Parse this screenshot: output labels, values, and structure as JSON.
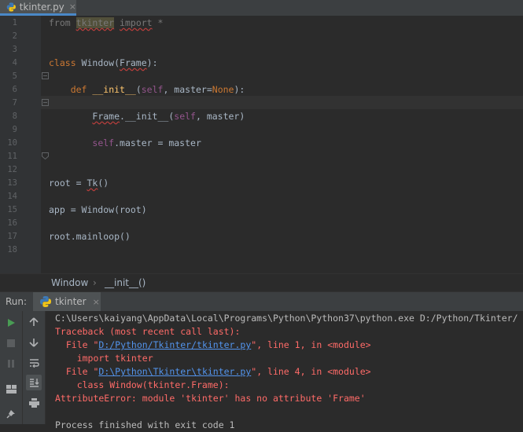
{
  "editor_tab": {
    "filename": "tkinter.py",
    "close": "×"
  },
  "code_lines": [
    {
      "n": "1",
      "html": "<span class='dim'>from</span> <span class='dim hl warn'>tkinter</span> <span class='dim warn'>import</span> <span class='dim'>*</span>"
    },
    {
      "n": "2",
      "html": ""
    },
    {
      "n": "3",
      "html": ""
    },
    {
      "n": "4",
      "html": "<span class='kw'>class</span> Window(<span class='warn'>Frame</span>):"
    },
    {
      "n": "5",
      "html": ""
    },
    {
      "n": "6",
      "html": "    <span class='kw'>def</span> <span class='fn'>__init__</span>(<span class='self'>self</span>, master=<span class='kw'>None</span>):"
    },
    {
      "n": "7",
      "html": ""
    },
    {
      "n": "8",
      "html": "        <span class='warn'>Frame</span>.__init__(<span class='self'>self</span>, master)"
    },
    {
      "n": "9",
      "html": ""
    },
    {
      "n": "10",
      "html": "        <span class='self'>self</span>.master = master"
    },
    {
      "n": "11",
      "html": ""
    },
    {
      "n": "12",
      "html": ""
    },
    {
      "n": "13",
      "html": "root = <span class='warn'>Tk</span>()"
    },
    {
      "n": "14",
      "html": ""
    },
    {
      "n": "15",
      "html": "app = Window(root)"
    },
    {
      "n": "16",
      "html": ""
    },
    {
      "n": "17",
      "html": "root.mainloop()"
    },
    {
      "n": "18",
      "html": ""
    }
  ],
  "breadcrumb": {
    "class_name": "Window",
    "separator": "›",
    "method_name": "__init__()"
  },
  "run_panel": {
    "label": "Run:",
    "tab_name": "tkinter",
    "close": "×"
  },
  "console_lines": [
    {
      "cls": "gray",
      "text": "C:\\Users\\kaiyang\\AppData\\Local\\Programs\\Python\\Python37\\python.exe D:/Python/Tkinter/"
    },
    {
      "cls": "red",
      "text": "Traceback (most recent call last):"
    },
    {
      "cls": "red",
      "html": "  File \"<span class='link'>D:/Python/Tkinter/tkinter.py</span>\", line 1, in &lt;module&gt;"
    },
    {
      "cls": "red",
      "text": "    import tkinter"
    },
    {
      "cls": "red",
      "html": "  File \"<span class='link'>D:\\Python\\Tkinter\\tkinter.py</span>\", line 4, in &lt;module&gt;"
    },
    {
      "cls": "red",
      "text": "    class Window(tkinter.Frame):"
    },
    {
      "cls": "red",
      "text": "AttributeError: module 'tkinter' has no attribute 'Frame'"
    },
    {
      "cls": "gray",
      "text": ""
    },
    {
      "cls": "gray",
      "text": "Process finished with exit code 1"
    }
  ],
  "colors": {
    "accent": "#4a88c7",
    "error": "#ff6b68",
    "link": "#5394ec",
    "run_green": "#499c54"
  },
  "icons": [
    "python-file-icon",
    "run-icon",
    "stop-icon",
    "pause-icon",
    "layout-icon",
    "pin-icon",
    "up-arrow-icon",
    "down-arrow-icon",
    "soft-wrap-icon",
    "scroll-to-end-icon",
    "print-icon"
  ]
}
